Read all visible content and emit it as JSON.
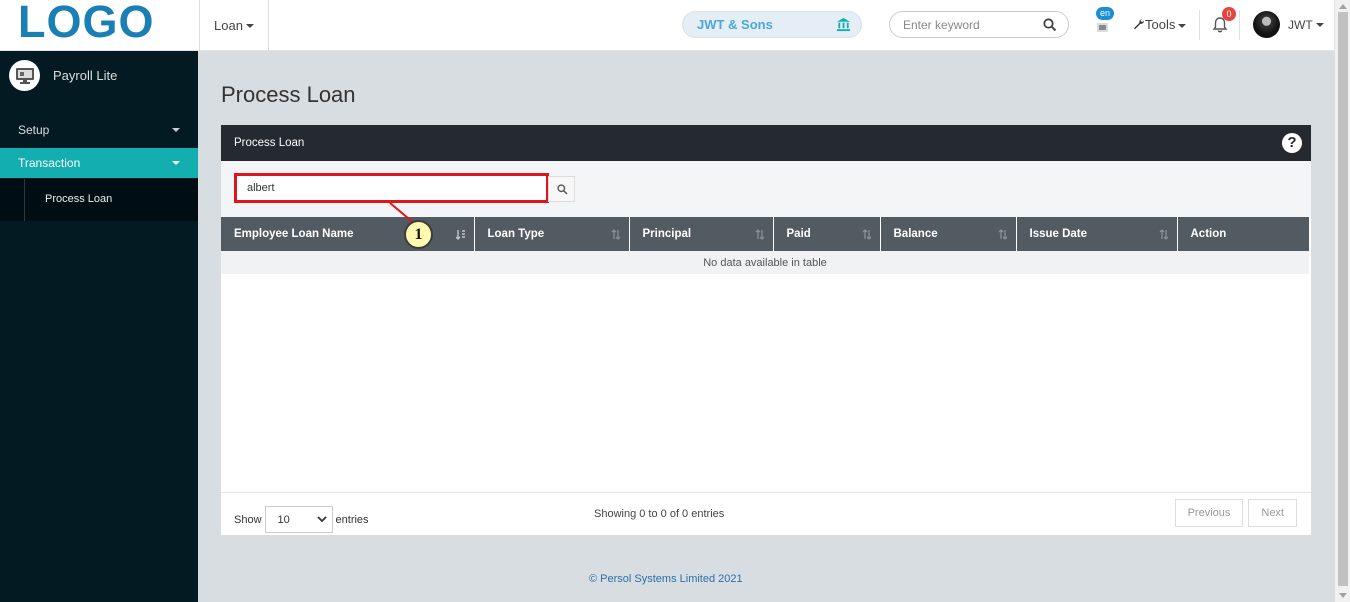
{
  "header": {
    "logo": "LOGO",
    "loan_menu": "Loan",
    "company": "JWT & Sons",
    "search_placeholder": "Enter keyword",
    "lang_badge": "en",
    "tools_label": "Tools",
    "notification_count": "0",
    "user_name": "JWT"
  },
  "sidebar": {
    "brand": "Payroll Lite",
    "items": [
      {
        "label": "Setup"
      },
      {
        "label": "Transaction"
      }
    ],
    "sub_item": "Process Loan"
  },
  "main": {
    "page_title": "Process Loan",
    "panel_title": "Process Loan",
    "help": "?",
    "filter_value": "albert",
    "callout": "1",
    "columns": [
      "Employee Loan Name",
      "Loan Type",
      "Principal",
      "Paid",
      "Balance",
      "Issue Date",
      "Action"
    ],
    "empty_message": "No data available in table",
    "show_label": "Show",
    "page_length": "10",
    "entries_label": "entries",
    "info": "Showing 0 to 0 of 0 entries",
    "prev_label": "Previous",
    "next_label": "Next"
  },
  "footer": "© Persol Systems Limited 2021",
  "colors": {
    "accent": "#13aeb0",
    "sidebar_bg": "#041a22",
    "highlight": "#e0151b"
  }
}
